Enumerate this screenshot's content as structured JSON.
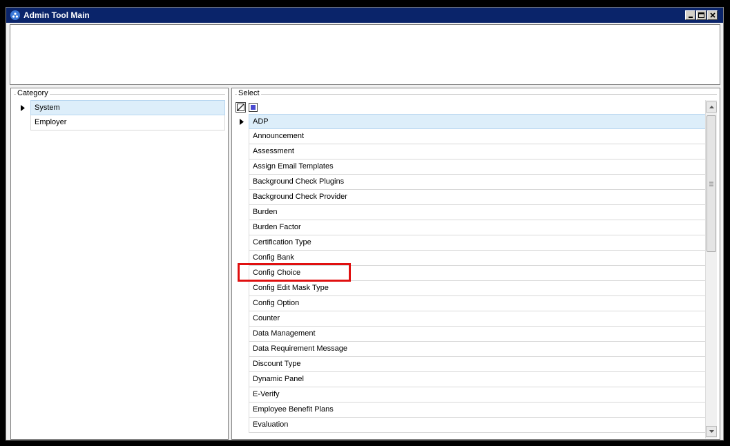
{
  "window": {
    "title": "Admin Tool Main"
  },
  "category": {
    "legend": "Category",
    "items": [
      {
        "label": "System",
        "selected": true
      },
      {
        "label": "Employer",
        "selected": false
      }
    ]
  },
  "select": {
    "legend": "Select",
    "items": [
      {
        "label": "ADP",
        "selected": true
      },
      {
        "label": "Announcement"
      },
      {
        "label": "Assessment"
      },
      {
        "label": "Assign Email Templates"
      },
      {
        "label": "Background Check Plugins"
      },
      {
        "label": "Background Check Provider"
      },
      {
        "label": "Burden"
      },
      {
        "label": "Burden Factor"
      },
      {
        "label": "Certification Type"
      },
      {
        "label": "Config Bank"
      },
      {
        "label": "Config Choice",
        "highlighted": true
      },
      {
        "label": "Config Edit Mask Type"
      },
      {
        "label": "Config Option"
      },
      {
        "label": "Counter"
      },
      {
        "label": "Data Management"
      },
      {
        "label": "Data Requirement Message"
      },
      {
        "label": "Discount Type"
      },
      {
        "label": "Dynamic Panel"
      },
      {
        "label": "E-Verify"
      },
      {
        "label": "Employee Benefit Plans"
      },
      {
        "label": "Evaluation"
      }
    ]
  },
  "colors": {
    "titlebar": "#0a246a",
    "selected_row": "#ddeefa",
    "highlight_box": "#e01010"
  }
}
